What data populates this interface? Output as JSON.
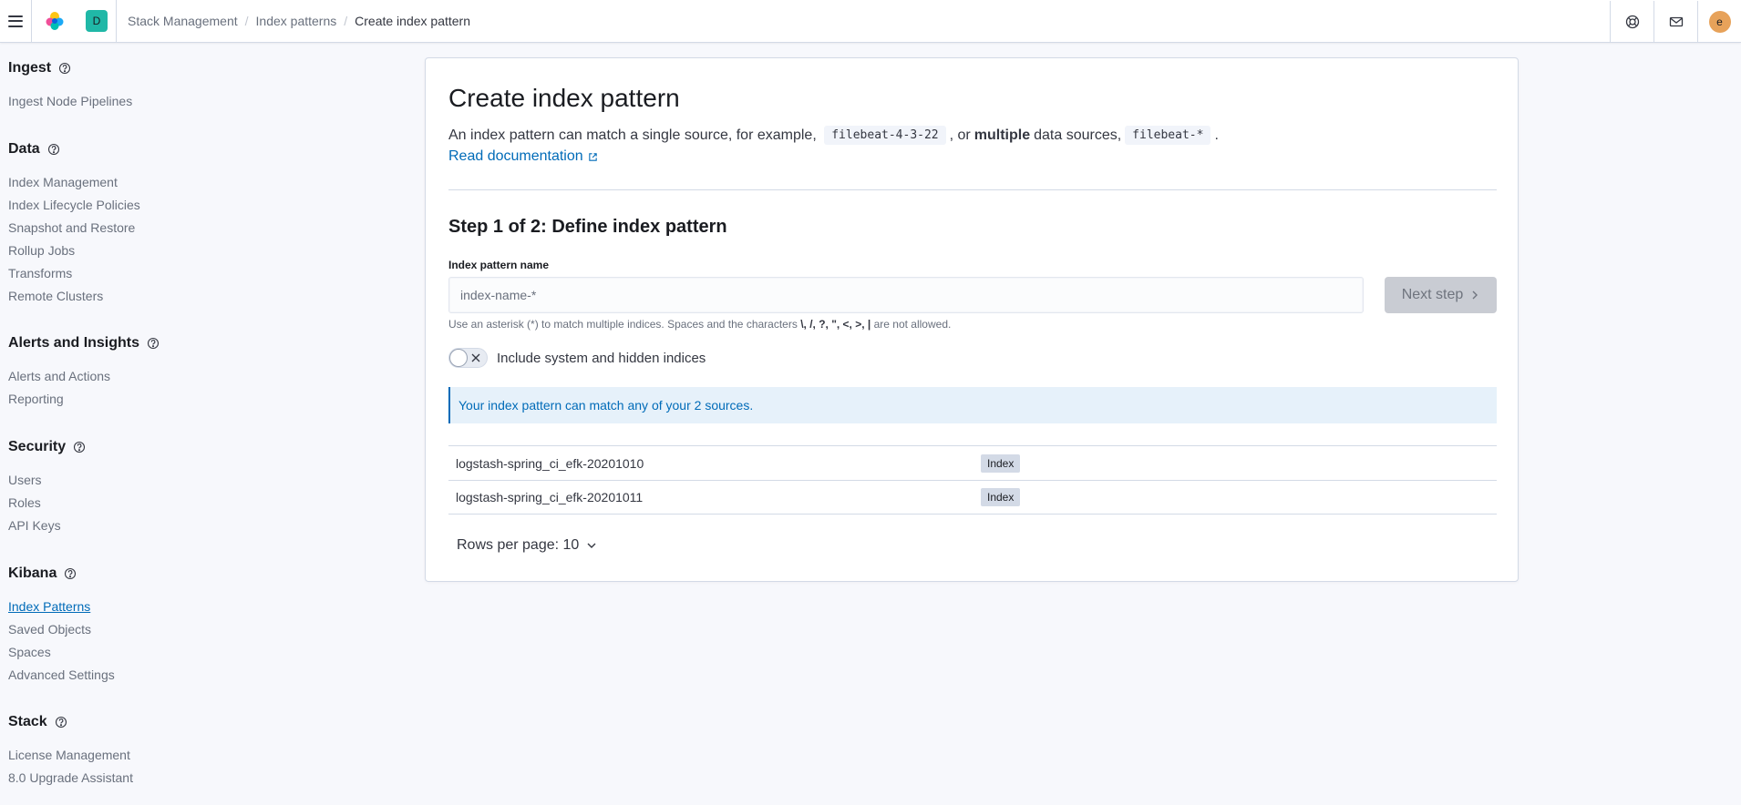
{
  "header": {
    "space_initial": "D",
    "user_initial": "e",
    "breadcrumbs": [
      "Stack Management",
      "Index patterns",
      "Create index pattern"
    ],
    "icons": [
      "menu-icon",
      "elastic-logo-icon",
      "help-icon",
      "mail-icon"
    ]
  },
  "sidebar": {
    "groups": [
      {
        "title": "Ingest",
        "items": [
          "Ingest Node Pipelines"
        ]
      },
      {
        "title": "Data",
        "items": [
          "Index Management",
          "Index Lifecycle Policies",
          "Snapshot and Restore",
          "Rollup Jobs",
          "Transforms",
          "Remote Clusters"
        ]
      },
      {
        "title": "Alerts and Insights",
        "items": [
          "Alerts and Actions",
          "Reporting"
        ]
      },
      {
        "title": "Security",
        "items": [
          "Users",
          "Roles",
          "API Keys"
        ]
      },
      {
        "title": "Kibana",
        "items": [
          "Index Patterns",
          "Saved Objects",
          "Spaces",
          "Advanced Settings"
        ]
      },
      {
        "title": "Stack",
        "items": [
          "License Management",
          "8.0 Upgrade Assistant"
        ]
      }
    ],
    "active_item": "Index Patterns"
  },
  "main": {
    "title": "Create index pattern",
    "desc_part1": "An index pattern can match a single source, for example,",
    "code1": "filebeat-4-3-22",
    "desc_part2": ", or",
    "desc_bold": "multiple",
    "desc_part3": "data sources,",
    "code2": "filebeat-*",
    "desc_part4": ".",
    "doc_link": "Read documentation",
    "step_title": "Step 1 of 2: Define index pattern",
    "field_label": "Index pattern name",
    "input_placeholder": "index-name-*",
    "input_value": "",
    "next_button": "Next step",
    "help_part1": "Use an asterisk (*) to match multiple indices. Spaces and the characters ",
    "help_chars": "\\, /, ?, \", <, >, |",
    "help_part2": " are not allowed.",
    "toggle_label": "Include system and hidden indices",
    "callout": "Your index pattern can match any of your 2 sources.",
    "rows": [
      {
        "name": "logstash-spring_ci_efk-20201010",
        "type": "Index"
      },
      {
        "name": "logstash-spring_ci_efk-20201011",
        "type": "Index"
      }
    ],
    "rows_per_page": "Rows per page: 10"
  },
  "colors": {
    "accent": "#006bb8",
    "space_avatar": "#20b8a7",
    "user_avatar": "#e7a25a"
  }
}
